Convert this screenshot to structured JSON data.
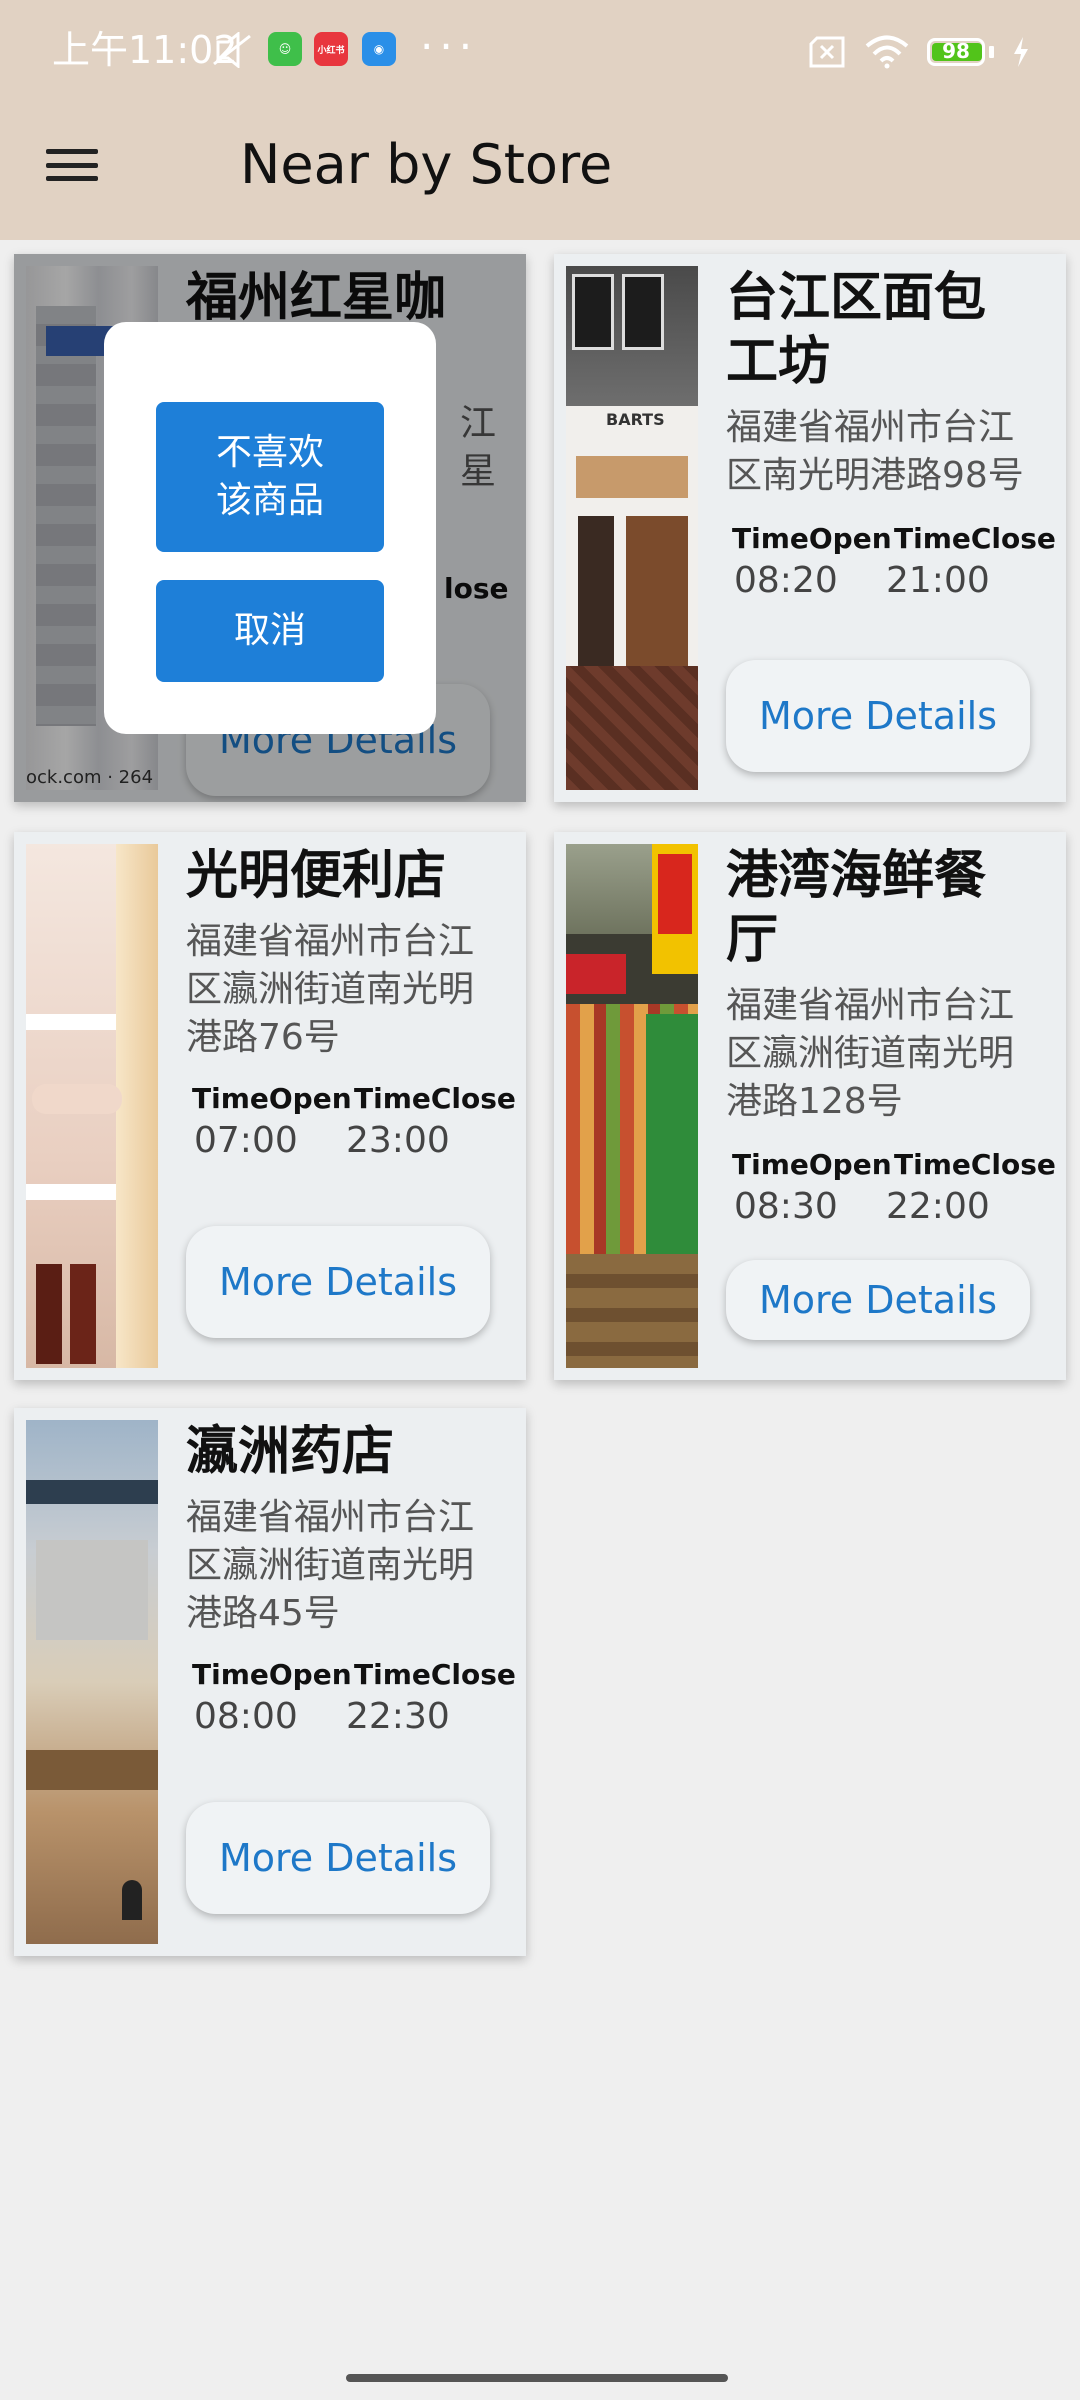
{
  "status_bar": {
    "time": "上午11:02",
    "badge_app2": "小红书",
    "battery": "98"
  },
  "header": {
    "title": "Near by Store",
    "menu_icon": "hamburger-menu-icon"
  },
  "labels": {
    "time_open": "TimeOpen",
    "time_close": "TimeClose",
    "more_details": "More Details"
  },
  "stores": [
    {
      "name": "福州红星咖",
      "address_lines": [
        "江",
        "星"
      ],
      "time_close_partial": "lose",
      "photo_caption": "ock.com · 264"
    },
    {
      "name_lines": [
        "台江区面包",
        "工坊"
      ],
      "address_lines": [
        "福建省福州市台江",
        "区南光明港路98号"
      ],
      "open": "08:20",
      "close": "21:00",
      "storefront_sign": "BARTS"
    },
    {
      "name": "光明便利店",
      "address_lines": [
        "福建省福州市台江",
        "区瀛洲街道南光明",
        "港路76号"
      ],
      "open": "07:00",
      "close": "23:00"
    },
    {
      "name_lines": [
        "港湾海鲜餐",
        "厅"
      ],
      "address_lines": [
        "福建省福州市台江",
        "区瀛洲街道南光明",
        "港路128号"
      ],
      "open": "08:30",
      "close": "22:00"
    },
    {
      "name": "瀛洲药店",
      "address_lines": [
        "福建省福州市台江",
        "区瀛洲街道南光明",
        "港路45号"
      ],
      "open": "08:00",
      "close": "22:30"
    }
  ],
  "popup": {
    "dislike_line1": "不喜欢",
    "dislike_line2": "该商品",
    "cancel": "取消"
  }
}
